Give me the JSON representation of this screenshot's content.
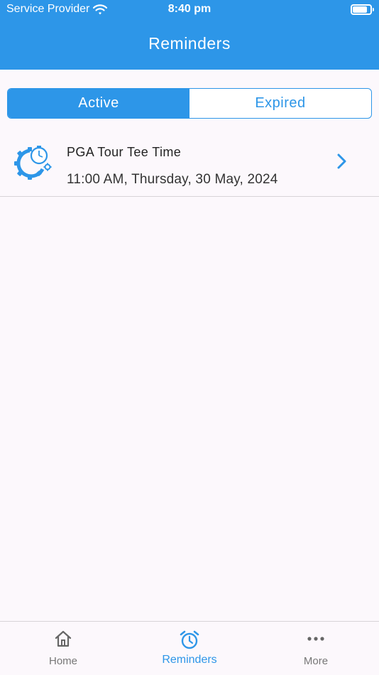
{
  "status_bar": {
    "carrier": "Service Provider",
    "time": "8:40 pm",
    "battery_level": 0.85
  },
  "header": {
    "title": "Reminders"
  },
  "segments": [
    {
      "label": "Active",
      "selected": true
    },
    {
      "label": "Expired",
      "selected": false
    }
  ],
  "reminders": [
    {
      "title": "PGA Tour Tee Time",
      "datetime": "11:00 AM, Thursday, 30 May, 2024",
      "icon": "gear-timer-icon"
    }
  ],
  "tabbar": {
    "items": [
      {
        "label": "Home",
        "icon": "home-icon"
      },
      {
        "label": "Reminders",
        "icon": "alarm-clock-icon",
        "selected": true
      },
      {
        "label": "More",
        "icon": "more-dots-icon"
      }
    ]
  },
  "colors": {
    "accent": "#2d96e8",
    "background": "#fcf8fc",
    "tab_inactive": "#777777"
  }
}
